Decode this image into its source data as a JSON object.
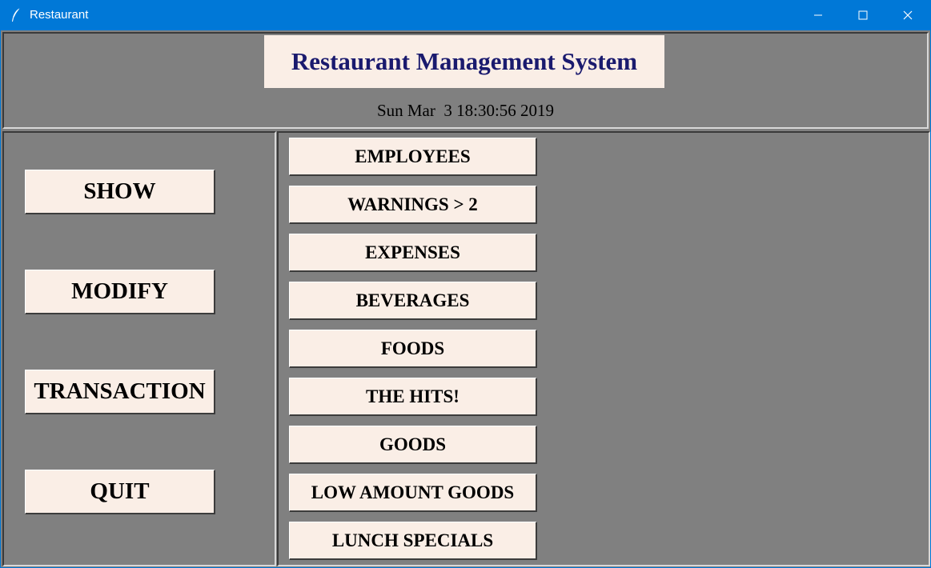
{
  "window": {
    "title": "Restaurant",
    "icon": "feather-icon",
    "accent_color": "#0078d7"
  },
  "header": {
    "app_title": "Restaurant Management System",
    "clock": "Sun Mar  3 18:30:56 2019"
  },
  "main_menu": {
    "items": [
      {
        "label": "SHOW"
      },
      {
        "label": "MODIFY"
      },
      {
        "label": "TRANSACTION"
      },
      {
        "label": "QUIT"
      }
    ]
  },
  "show_menu": {
    "items": [
      {
        "label": "EMPLOYEES"
      },
      {
        "label": "WARNINGS > 2"
      },
      {
        "label": "EXPENSES"
      },
      {
        "label": "BEVERAGES"
      },
      {
        "label": "FOODS"
      },
      {
        "label": "THE HITS!"
      },
      {
        "label": "GOODS"
      },
      {
        "label": "LOW AMOUNT GOODS"
      },
      {
        "label": "LUNCH SPECIALS"
      }
    ]
  },
  "colors": {
    "background": "#808080",
    "button_face": "#faeee6",
    "title_text": "#1a1a6e"
  }
}
